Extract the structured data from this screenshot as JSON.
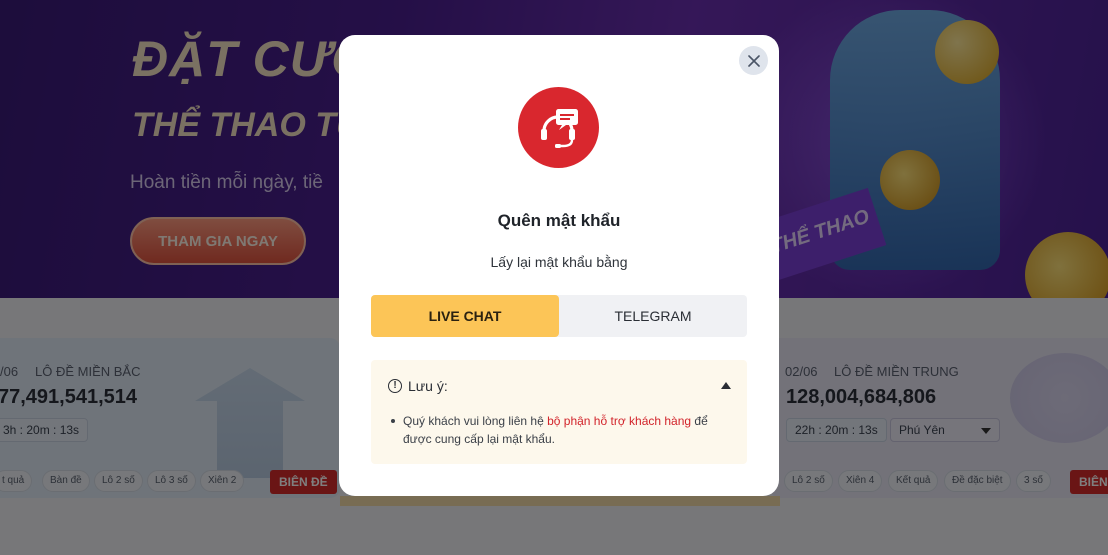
{
  "background": {
    "banner": {
      "title_line1": "ĐẶT CƯỢC",
      "title_line2": "THỂ THAO TỤ",
      "subtitle": "Hoàn tiền mỗi ngày, tiề",
      "cta_label": "THAM GIA NGAY",
      "flag_text": "THỂ THAO"
    },
    "lottery_left": {
      "date_label": "/06",
      "region": "LÔ ĐỀ MIỀN BẮC",
      "amount": "77,491,541,514",
      "timer": "3h : 20m : 13s",
      "chips": [
        "t quả",
        "Bàn đề",
        "Lô 2 số",
        "Lô 3 số",
        "Xiên 2"
      ],
      "button_label": "BIÊN ĐỀ"
    },
    "lottery_right": {
      "date_label": "02/06",
      "region": "LÔ ĐỀ MIỀN TRUNG",
      "amount": "128,004,684,806",
      "timer": "22h : 20m : 13s",
      "province": "Phú Yên",
      "chips": [
        "Lô 2 số",
        "Xiên 4",
        "Kết quả",
        "Đề đặc biệt",
        "3 số"
      ],
      "button_label": "BIÊN"
    }
  },
  "modal": {
    "title": "Quên mật khẩu",
    "subtitle": "Lấy lại mật khẩu bằng",
    "close_icon": "close-icon",
    "logo_icon": "support-headset-icon",
    "tabs": [
      {
        "label": "LIVE CHAT",
        "active": true
      },
      {
        "label": "TELEGRAM",
        "active": false
      }
    ],
    "note": {
      "heading": "Lưu ý:",
      "icon": "info-icon",
      "text_before": "Quý khách vui lòng liên hệ ",
      "link_text": "bộ phận hỗ trợ khách hàng",
      "text_after": " để được cung cấp lại mật khẩu."
    }
  },
  "colors": {
    "accent_yellow": "#fcc557",
    "brand_red": "#d9272e",
    "note_bg": "#fdf8ec",
    "link_red": "#d2232a"
  }
}
